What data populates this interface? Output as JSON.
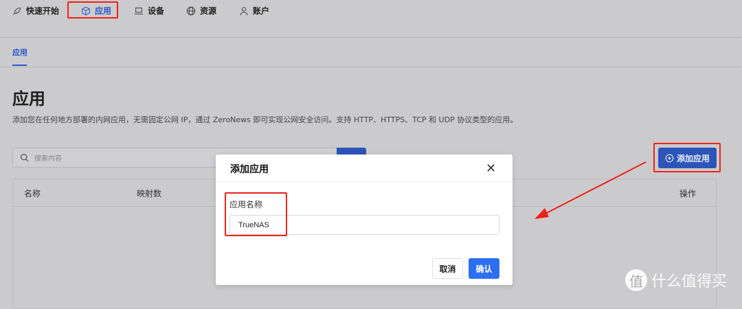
{
  "nav": {
    "items": [
      {
        "label": "快速开始",
        "icon": "rocket-icon"
      },
      {
        "label": "应用",
        "icon": "cube-icon",
        "active": true
      },
      {
        "label": "设备",
        "icon": "laptop-icon"
      },
      {
        "label": "资源",
        "icon": "globe-icon"
      },
      {
        "label": "账户",
        "icon": "user-icon"
      }
    ]
  },
  "subtabs": [
    "应用"
  ],
  "page": {
    "title": "应用",
    "description": "添加您在任何地方部署的内网应用，无需固定公网 IP，通过 ZeroNews 即可实现公网安全访问。支持 HTTP、HTTPS、TCP 和 UDP 协议类型的应用。"
  },
  "search": {
    "placeholder": "搜索内容"
  },
  "add_button": "添加应用",
  "table": {
    "columns": [
      "名称",
      "映射数",
      "操作"
    ]
  },
  "dialog": {
    "title": "添加应用",
    "field_label": "应用名称",
    "field_value": "TrueNAS",
    "cancel": "取消",
    "confirm": "确认"
  },
  "watermark": {
    "logo": "值",
    "text": "什么值得买"
  },
  "colors": {
    "accent": "#2e6ff0",
    "annotation": "#f0201a"
  }
}
